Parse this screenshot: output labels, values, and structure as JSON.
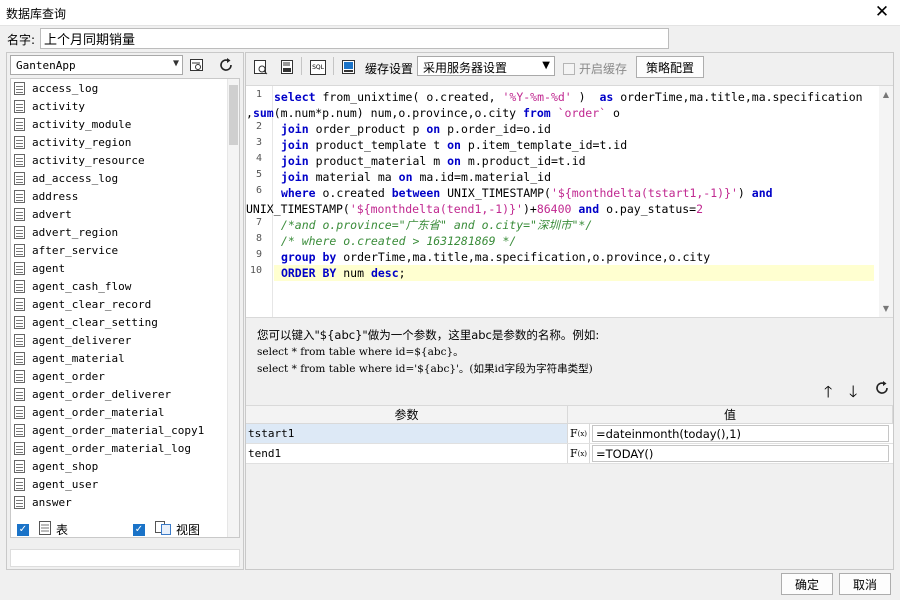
{
  "window": {
    "title": "数据库查询"
  },
  "name_row": {
    "label": "名字:",
    "value": "上个月同期销量"
  },
  "left": {
    "db_select": "GantenApp",
    "tables": [
      "access_log",
      "activity",
      "activity_module",
      "activity_region",
      "activity_resource",
      "ad_access_log",
      "address",
      "advert",
      "advert_region",
      "after_service",
      "agent",
      "agent_cash_flow",
      "agent_clear_record",
      "agent_clear_setting",
      "agent_deliverer",
      "agent_material",
      "agent_order",
      "agent_order_deliverer",
      "agent_order_material",
      "agent_order_material_copy1",
      "agent_order_material_log",
      "agent_shop",
      "agent_user",
      "answer"
    ],
    "show_table_label": "表",
    "show_view_label": "视图"
  },
  "toolbar": {
    "sql_icon_text": "SQL",
    "cache_settings_label": "缓存设置",
    "cache_select": "采用服务器设置",
    "enable_cache_label": "开启缓存",
    "strategy_label": "策略配置"
  },
  "editor": {
    "line_numbers": [
      "1",
      "2",
      "3",
      "4",
      "5",
      "6",
      "7",
      "8",
      "9",
      "10"
    ]
  },
  "hint": {
    "line1": "您可以键入\"${abc}\"做为一个参数，这里abc是参数的名称。例如:",
    "line2": "select * from table where id=${abc}。",
    "line3": "select * from table where id='${abc}'。(如果id字段为字符串类型)"
  },
  "params": {
    "header_name": "参数",
    "header_value": "值",
    "rows": [
      {
        "name": "tstart1",
        "value": "=dateinmonth(today(),1)"
      },
      {
        "name": "tend1",
        "value": "=TODAY()"
      }
    ]
  },
  "footer": {
    "ok": "确定",
    "cancel": "取消"
  }
}
